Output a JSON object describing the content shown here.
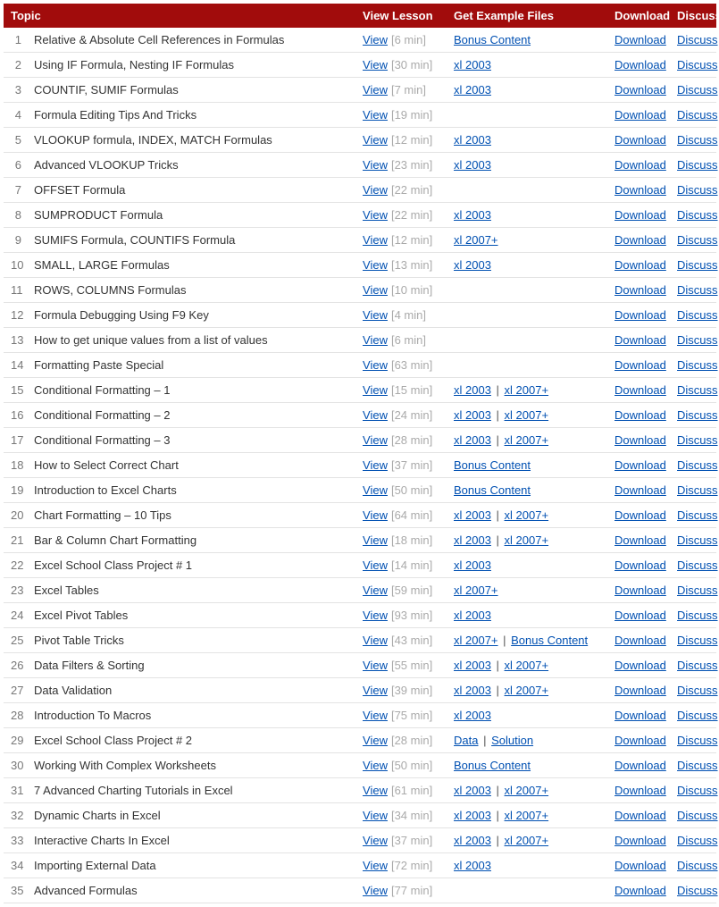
{
  "headers": {
    "topic": "Topic",
    "view": "View Lesson",
    "examples": "Get Example Files",
    "download": "Download",
    "discuss": "Discuss"
  },
  "labels": {
    "view": "View",
    "download": "Download",
    "discuss": "Discuss",
    "separator": "|"
  },
  "rows": [
    {
      "n": 1,
      "topic": "Relative & Absolute Cell References in Formulas",
      "dur": "[6 min]",
      "examples": [
        "Bonus Content"
      ]
    },
    {
      "n": 2,
      "topic": "Using IF Formula, Nesting IF Formulas",
      "dur": "[30 min]",
      "examples": [
        "xl 2003"
      ]
    },
    {
      "n": 3,
      "topic": "COUNTIF, SUMIF Formulas",
      "dur": "[7 min]",
      "examples": [
        "xl 2003"
      ]
    },
    {
      "n": 4,
      "topic": "Formula Editing Tips And Tricks",
      "dur": "[19 min]",
      "examples": []
    },
    {
      "n": 5,
      "topic": "VLOOKUP formula, INDEX, MATCH Formulas",
      "dur": "[12 min]",
      "examples": [
        "xl 2003"
      ]
    },
    {
      "n": 6,
      "topic": "Advanced VLOOKUP Tricks",
      "dur": "[23 min]",
      "examples": [
        "xl 2003"
      ]
    },
    {
      "n": 7,
      "topic": "OFFSET Formula",
      "dur": "[22 min]",
      "examples": []
    },
    {
      "n": 8,
      "topic": "SUMPRODUCT Formula",
      "dur": "[22 min]",
      "examples": [
        "xl 2003"
      ]
    },
    {
      "n": 9,
      "topic": "SUMIFS Formula, COUNTIFS Formula",
      "dur": "[12 min]",
      "examples": [
        "xl 2007+"
      ]
    },
    {
      "n": 10,
      "topic": "SMALL, LARGE Formulas",
      "dur": "[13 min]",
      "examples": [
        "xl 2003"
      ]
    },
    {
      "n": 11,
      "topic": "ROWS, COLUMNS Formulas",
      "dur": "[10 min]",
      "examples": []
    },
    {
      "n": 12,
      "topic": "Formula Debugging Using F9 Key",
      "dur": "[4 min]",
      "examples": []
    },
    {
      "n": 13,
      "topic": "How to get unique values from a list of values",
      "dur": "[6 min]",
      "examples": []
    },
    {
      "n": 14,
      "topic": "Formatting Paste Special",
      "dur": "[63 min]",
      "examples": []
    },
    {
      "n": 15,
      "topic": "Conditional Formatting – 1",
      "dur": "[15 min]",
      "examples": [
        "xl 2003",
        "xl 2007+"
      ]
    },
    {
      "n": 16,
      "topic": "Conditional Formatting – 2",
      "dur": "[24 min]",
      "examples": [
        "xl 2003",
        "xl 2007+"
      ]
    },
    {
      "n": 17,
      "topic": "Conditional Formatting – 3",
      "dur": "[28 min]",
      "examples": [
        "xl 2003",
        "xl 2007+"
      ]
    },
    {
      "n": 18,
      "topic": "How to Select Correct Chart",
      "dur": "[37 min]",
      "examples": [
        "Bonus Content"
      ]
    },
    {
      "n": 19,
      "topic": "Introduction to Excel Charts",
      "dur": "[50 min]",
      "examples": [
        "Bonus Content"
      ]
    },
    {
      "n": 20,
      "topic": "Chart Formatting – 10 Tips",
      "dur": "[64 min]",
      "examples": [
        "xl 2003",
        "xl 2007+"
      ]
    },
    {
      "n": 21,
      "topic": "Bar & Column Chart Formatting",
      "dur": "[18 min]",
      "examples": [
        "xl 2003",
        "xl 2007+"
      ]
    },
    {
      "n": 22,
      "topic": "Excel School Class Project # 1",
      "dur": "[14 min]",
      "examples": [
        "xl 2003"
      ]
    },
    {
      "n": 23,
      "topic": "Excel Tables",
      "dur": "[59 min]",
      "examples": [
        "xl 2007+"
      ]
    },
    {
      "n": 24,
      "topic": "Excel Pivot Tables",
      "dur": "[93 min]",
      "examples": [
        "xl 2003"
      ]
    },
    {
      "n": 25,
      "topic": "Pivot Table Tricks",
      "dur": "[43 min]",
      "examples": [
        "xl 2007+",
        "Bonus Content"
      ]
    },
    {
      "n": 26,
      "topic": "Data Filters & Sorting",
      "dur": "[55 min]",
      "examples": [
        "xl 2003",
        "xl 2007+"
      ]
    },
    {
      "n": 27,
      "topic": "Data Validation",
      "dur": "[39 min]",
      "examples": [
        "xl 2003",
        "xl 2007+"
      ]
    },
    {
      "n": 28,
      "topic": "Introduction To Macros",
      "dur": "[75 min]",
      "examples": [
        "xl 2003"
      ]
    },
    {
      "n": 29,
      "topic": "Excel School Class Project # 2",
      "dur": "[28 min]",
      "examples": [
        "Data",
        "Solution"
      ]
    },
    {
      "n": 30,
      "topic": "Working With Complex Worksheets",
      "dur": "[50 min]",
      "examples": [
        "Bonus Content"
      ]
    },
    {
      "n": 31,
      "topic": "7 Advanced Charting Tutorials in Excel",
      "dur": "[61 min]",
      "examples": [
        "xl 2003",
        "xl 2007+"
      ]
    },
    {
      "n": 32,
      "topic": "Dynamic Charts in Excel",
      "dur": "[34 min]",
      "examples": [
        "xl 2003",
        "xl 2007+"
      ]
    },
    {
      "n": 33,
      "topic": "Interactive Charts In Excel",
      "dur": "[37 min]",
      "examples": [
        "xl 2003",
        "xl 2007+"
      ]
    },
    {
      "n": 34,
      "topic": "Importing External Data",
      "dur": "[72 min]",
      "examples": [
        "xl 2003"
      ]
    },
    {
      "n": 35,
      "topic": "Advanced Formulas",
      "dur": "[77 min]",
      "examples": []
    }
  ]
}
